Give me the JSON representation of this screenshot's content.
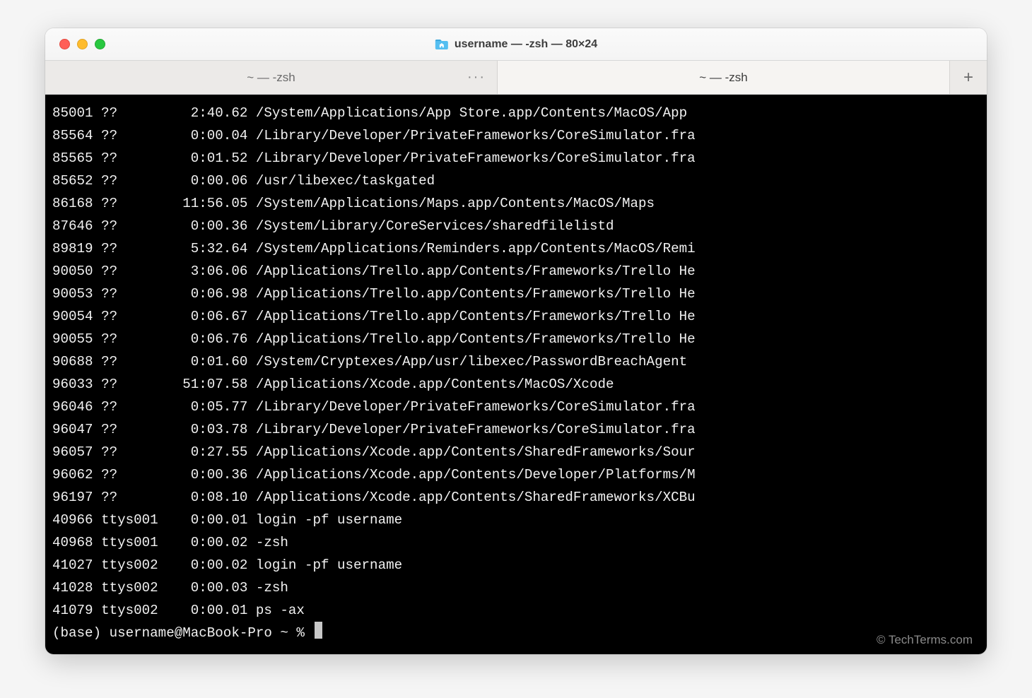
{
  "window": {
    "title": "username — -zsh — 80×24"
  },
  "tabs": {
    "items": [
      {
        "label": "~ — -zsh",
        "active": false,
        "overflow": true
      },
      {
        "label": "~ — -zsh",
        "active": true,
        "overflow": false
      }
    ],
    "new_tab_label": "+"
  },
  "terminal": {
    "rows": [
      {
        "pid": "85001",
        "tty": "??",
        "time": "2:40.62",
        "cmd": "/System/Applications/App Store.app/Contents/MacOS/App"
      },
      {
        "pid": "85564",
        "tty": "??",
        "time": "0:00.04",
        "cmd": "/Library/Developer/PrivateFrameworks/CoreSimulator.fra"
      },
      {
        "pid": "85565",
        "tty": "??",
        "time": "0:01.52",
        "cmd": "/Library/Developer/PrivateFrameworks/CoreSimulator.fra"
      },
      {
        "pid": "85652",
        "tty": "??",
        "time": "0:00.06",
        "cmd": "/usr/libexec/taskgated"
      },
      {
        "pid": "86168",
        "tty": "??",
        "time": "11:56.05",
        "cmd": "/System/Applications/Maps.app/Contents/MacOS/Maps"
      },
      {
        "pid": "87646",
        "tty": "??",
        "time": "0:00.36",
        "cmd": "/System/Library/CoreServices/sharedfilelistd"
      },
      {
        "pid": "89819",
        "tty": "??",
        "time": "5:32.64",
        "cmd": "/System/Applications/Reminders.app/Contents/MacOS/Remi"
      },
      {
        "pid": "90050",
        "tty": "??",
        "time": "3:06.06",
        "cmd": "/Applications/Trello.app/Contents/Frameworks/Trello He"
      },
      {
        "pid": "90053",
        "tty": "??",
        "time": "0:06.98",
        "cmd": "/Applications/Trello.app/Contents/Frameworks/Trello He"
      },
      {
        "pid": "90054",
        "tty": "??",
        "time": "0:06.67",
        "cmd": "/Applications/Trello.app/Contents/Frameworks/Trello He"
      },
      {
        "pid": "90055",
        "tty": "??",
        "time": "0:06.76",
        "cmd": "/Applications/Trello.app/Contents/Frameworks/Trello He"
      },
      {
        "pid": "90688",
        "tty": "??",
        "time": "0:01.60",
        "cmd": "/System/Cryptexes/App/usr/libexec/PasswordBreachAgent"
      },
      {
        "pid": "96033",
        "tty": "??",
        "time": "51:07.58",
        "cmd": "/Applications/Xcode.app/Contents/MacOS/Xcode"
      },
      {
        "pid": "96046",
        "tty": "??",
        "time": "0:05.77",
        "cmd": "/Library/Developer/PrivateFrameworks/CoreSimulator.fra"
      },
      {
        "pid": "96047",
        "tty": "??",
        "time": "0:03.78",
        "cmd": "/Library/Developer/PrivateFrameworks/CoreSimulator.fra"
      },
      {
        "pid": "96057",
        "tty": "??",
        "time": "0:27.55",
        "cmd": "/Applications/Xcode.app/Contents/SharedFrameworks/Sour"
      },
      {
        "pid": "96062",
        "tty": "??",
        "time": "0:00.36",
        "cmd": "/Applications/Xcode.app/Contents/Developer/Platforms/M"
      },
      {
        "pid": "96197",
        "tty": "??",
        "time": "0:08.10",
        "cmd": "/Applications/Xcode.app/Contents/SharedFrameworks/XCBu"
      },
      {
        "pid": "40966",
        "tty": "ttys001",
        "time": "0:00.01",
        "cmd": "login -pf username"
      },
      {
        "pid": "40968",
        "tty": "ttys001",
        "time": "0:00.02",
        "cmd": "-zsh"
      },
      {
        "pid": "41027",
        "tty": "ttys002",
        "time": "0:00.02",
        "cmd": "login -pf username"
      },
      {
        "pid": "41028",
        "tty": "ttys002",
        "time": "0:00.03",
        "cmd": "-zsh"
      },
      {
        "pid": "41079",
        "tty": "ttys002",
        "time": "0:00.01",
        "cmd": "ps -ax"
      }
    ],
    "prompt": "(base) username@MacBook-Pro ~ %"
  },
  "watermark": "© TechTerms.com"
}
